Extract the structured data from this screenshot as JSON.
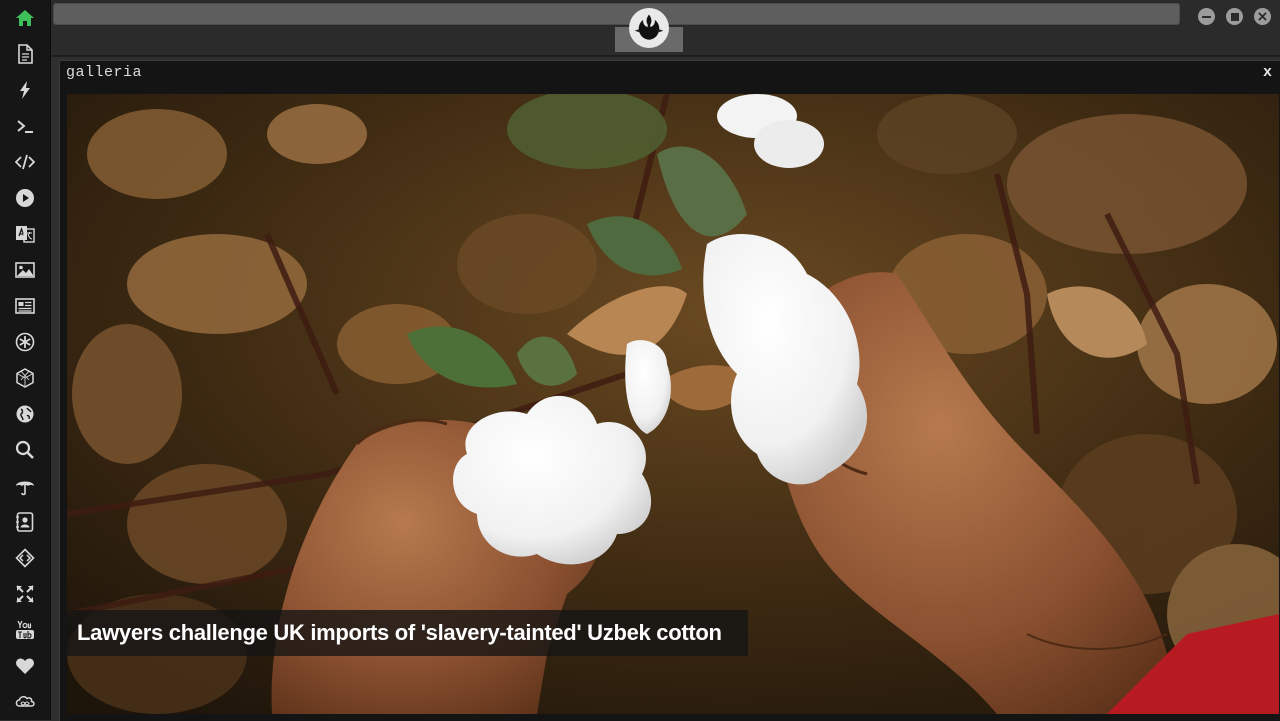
{
  "dock": {
    "items": [
      {
        "name": "home-icon",
        "active": true
      },
      {
        "name": "document-icon"
      },
      {
        "name": "lightning-icon"
      },
      {
        "name": "terminal-icon"
      },
      {
        "name": "code-icon"
      },
      {
        "name": "play-icon"
      },
      {
        "name": "translate-icon"
      },
      {
        "name": "image-icon"
      },
      {
        "name": "newspaper-icon"
      },
      {
        "name": "settings-asterisk-icon"
      },
      {
        "name": "cube-icon"
      },
      {
        "name": "globe-icon"
      },
      {
        "name": "search-icon"
      },
      {
        "name": "umbrella-icon"
      },
      {
        "name": "contact-card-icon"
      },
      {
        "name": "code-diamond-icon"
      },
      {
        "name": "expand-icon"
      },
      {
        "name": "youtube-icon"
      },
      {
        "name": "heart-icon"
      },
      {
        "name": "infinity-cloud-icon"
      }
    ],
    "active_color": "#3fbf5a",
    "icon_color": "#d8d8d8"
  },
  "topbar": {
    "logo": "rebel-alliance-icon",
    "window_controls": [
      "minimize-icon",
      "maximize-icon",
      "close-icon"
    ]
  },
  "gallery": {
    "title": "galleria",
    "close_label": "x",
    "image": "photo of hands picking white cotton bolls from a cotton plant",
    "caption": "Lawyers challenge UK imports of 'slavery-tainted' Uzbek cotton"
  }
}
